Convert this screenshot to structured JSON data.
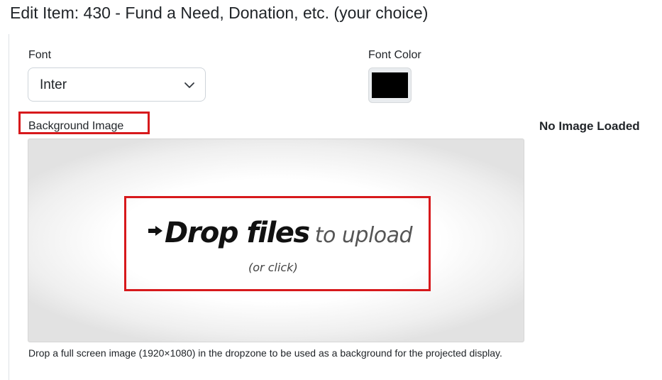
{
  "page_title": "Edit Item: 430 - Fund a Need, Donation, etc. (your choice)",
  "font": {
    "label": "Font",
    "selected_value": "Inter"
  },
  "font_color": {
    "label": "Font Color",
    "value": "#000000"
  },
  "background_image": {
    "label": "Background Image",
    "status": "No Image Loaded"
  },
  "dropzone": {
    "title_bold": "Drop files",
    "title_light": "to upload",
    "subtitle": "(or click)",
    "help_text": "Drop a full screen image (1920×1080) in the dropzone to be used as a background for the projected display."
  },
  "icons": {
    "select_indicator": "chevron-down-icon",
    "drop_indicator": "arrow-right-icon"
  },
  "colors": {
    "highlight": "#d7191c"
  }
}
